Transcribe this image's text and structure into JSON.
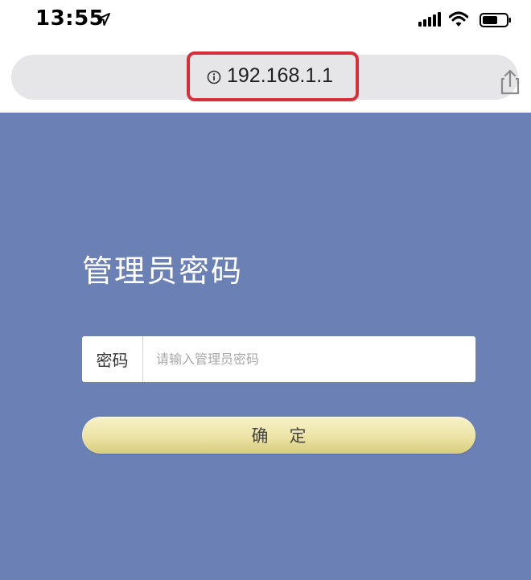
{
  "status_bar": {
    "time": "13:55"
  },
  "browser": {
    "url": "192.168.1.1",
    "highlight_color": "#d72f3a"
  },
  "login": {
    "title": "管理员密码",
    "password_label": "密码",
    "password_placeholder": "请输入管理员密码",
    "password_value": "",
    "confirm_label": "确定",
    "background_color": "#6b81b6"
  },
  "icons": [
    "location-arrow-icon",
    "cellular-signal-icon",
    "wifi-icon",
    "battery-icon",
    "info-icon",
    "share-icon"
  ]
}
